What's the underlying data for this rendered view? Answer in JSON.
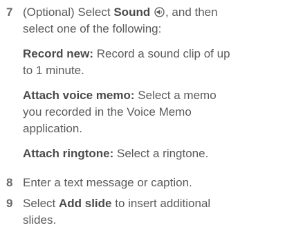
{
  "steps": [
    {
      "number": "7",
      "prefix": "(Optional)  Select ",
      "bold": "Sound",
      "suffix_line1": ", and then",
      "line2": "select one of the following:"
    },
    {
      "number": "8",
      "text": "Enter a text message or caption."
    },
    {
      "number": "9",
      "prefix": "Select ",
      "bold": "Add slide",
      "suffix": " to insert additional",
      "line2": "slides."
    }
  ],
  "options": [
    {
      "label": "Record new:",
      "text_line1": " Record a sound clip of up",
      "text_line2": "to 1 minute."
    },
    {
      "label": "Attach voice memo:",
      "text_line1": " Select a memo",
      "text_line2": "you recorded in the Voice Memo",
      "text_line3": "application."
    },
    {
      "label": "Attach ringtone:",
      "text_line1": " Select a ringtone."
    }
  ],
  "icons": {
    "sound": "sound-icon"
  }
}
